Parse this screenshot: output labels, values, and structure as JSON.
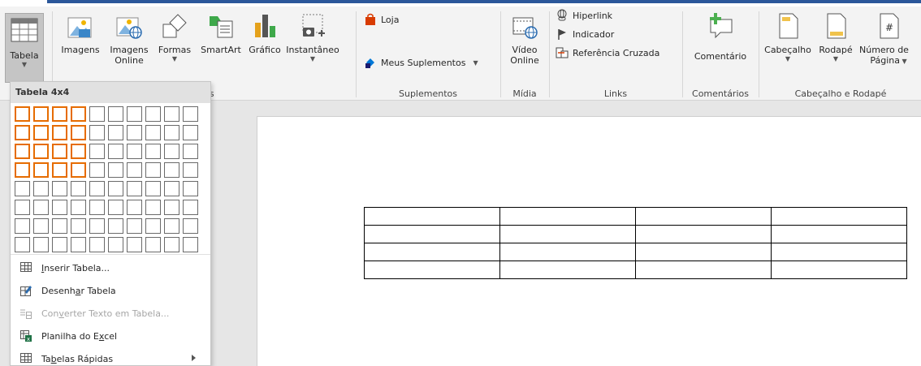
{
  "ribbon": {
    "buttons": {
      "tabela": {
        "label": "Tabela"
      },
      "imagens": {
        "label": "Imagens"
      },
      "imagens_online": {
        "line1": "Imagens",
        "line2": "Online"
      },
      "formas": {
        "label": "Formas"
      },
      "smartart": {
        "label": "SmartArt"
      },
      "grafico": {
        "label": "Gráfico"
      },
      "instantaneo": {
        "label": "Instantâneo"
      },
      "loja": {
        "label": "Loja"
      },
      "meus_suplementos": {
        "label": "Meus Suplementos"
      },
      "video_online": {
        "line1": "Vídeo",
        "line2": "Online"
      },
      "hiperlink": {
        "label": "Hiperlink"
      },
      "indicador": {
        "label": "Indicador"
      },
      "referencia_cruzada": {
        "label": "Referência Cruzada"
      },
      "comentario": {
        "label": "Comentário"
      },
      "cabecalho": {
        "label": "Cabeçalho"
      },
      "rodape": {
        "label": "Rodapé"
      },
      "numero_pagina": {
        "line1": "Número de",
        "line2": "Página"
      }
    },
    "groups": {
      "ilustracoes_partial": "ções",
      "suplementos": "Suplementos",
      "midia": "Mídia",
      "links": "Links",
      "comentarios": "Comentários",
      "cabecalho_rodape": "Cabeçalho e Rodapé"
    }
  },
  "table_dropdown": {
    "header": "Tabela 4x4",
    "grid": {
      "rows": 8,
      "cols": 10,
      "selected_rows": 4,
      "selected_cols": 4
    },
    "menu": [
      {
        "pre": "",
        "accel": "I",
        "post": "nserir Tabela...",
        "icon": "table-icon",
        "disabled": false
      },
      {
        "pre": "Desenh",
        "accel": "a",
        "post": "r Tabela",
        "icon": "pencil-table-icon",
        "disabled": false
      },
      {
        "pre": "Con",
        "accel": "v",
        "post": "erter Texto em Tabela...",
        "icon": "convert-text-icon",
        "disabled": true
      },
      {
        "pre": "Planilha do E",
        "accel": "x",
        "post": "cel",
        "icon": "excel-icon",
        "disabled": false
      },
      {
        "pre": "Ta",
        "accel": "b",
        "post": "elas Rápidas",
        "icon": "quick-tables-icon",
        "disabled": false
      }
    ]
  },
  "document": {
    "table": {
      "rows": 4,
      "cols": 4
    }
  },
  "colors": {
    "accent_blue": "#2b579a",
    "grid_selected": "#e66c00",
    "loja_red": "#d83b01",
    "addin_blue": "#0078d7",
    "comment_green": "#4caf50"
  }
}
